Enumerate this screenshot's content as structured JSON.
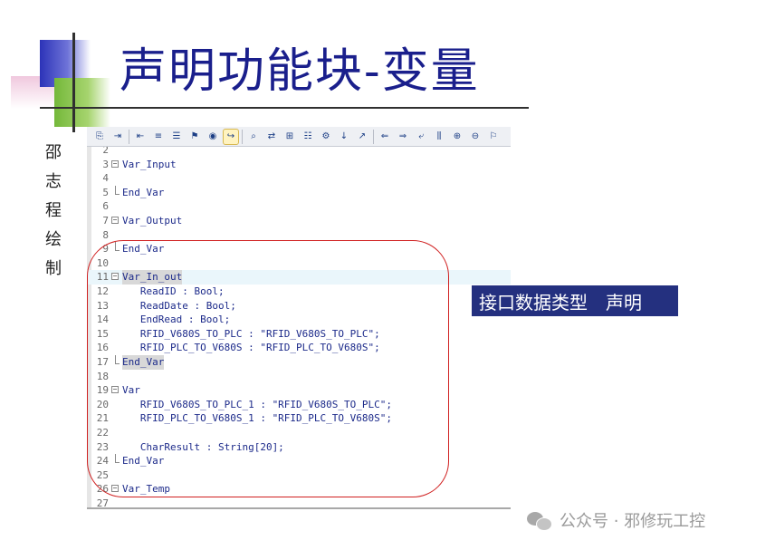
{
  "slide": {
    "title": "声明功能块-变量",
    "side_caption": "邵志程绘制",
    "callout": "接口数据类型　声明",
    "watermark": "公众号 · 邪修玩工控"
  },
  "toolbar": {
    "buttons": [
      "copy-icon",
      "indent-icon",
      "outdent-icon",
      "comment-icon",
      "uncomment-icon",
      "bookmark-icon",
      "breakpoint-icon",
      "goto-icon",
      "find-icon",
      "replace-icon",
      "toggle-icon",
      "list-icon",
      "settings-icon",
      "step-icon",
      "jump-icon",
      "align-left-icon",
      "align-right-icon",
      "wrap-icon",
      "split-icon",
      "insert-icon",
      "delete-icon",
      "flag-icon"
    ]
  },
  "editor": {
    "lines": [
      {
        "n": "2",
        "text": ""
      },
      {
        "n": "3",
        "text": "Var_Input"
      },
      {
        "n": "4",
        "text": ""
      },
      {
        "n": "5",
        "text": "End_Var"
      },
      {
        "n": "6",
        "text": ""
      },
      {
        "n": "7",
        "text": "Var_Output"
      },
      {
        "n": "8",
        "text": ""
      },
      {
        "n": "9",
        "text": "End_Var"
      },
      {
        "n": "10",
        "text": ""
      },
      {
        "n": "11",
        "text": "Var_In_out"
      },
      {
        "n": "12",
        "text": "   ReadID : Bool;"
      },
      {
        "n": "13",
        "text": "   ReadDate : Bool;"
      },
      {
        "n": "14",
        "text": "   EndRead : Bool;"
      },
      {
        "n": "15",
        "text": "   RFID_V680S_TO_PLC : \"RFID_V680S_TO_PLC\";"
      },
      {
        "n": "16",
        "text": "   RFID_PLC_TO_V680S : \"RFID_PLC_TO_V680S\";"
      },
      {
        "n": "17",
        "text": "End_Var"
      },
      {
        "n": "18",
        "text": ""
      },
      {
        "n": "19",
        "text": "Var"
      },
      {
        "n": "20",
        "text": "   RFID_V680S_TO_PLC_1 : \"RFID_V680S_TO_PLC\";"
      },
      {
        "n": "21",
        "text": "   RFID_PLC_TO_V680S_1 : \"RFID_PLC_TO_V680S\";"
      },
      {
        "n": "22",
        "text": ""
      },
      {
        "n": "23",
        "text": "   CharResult : String[20];"
      },
      {
        "n": "24",
        "text": "End_Var"
      },
      {
        "n": "25",
        "text": ""
      },
      {
        "n": "26",
        "text": "Var_Temp"
      },
      {
        "n": "27",
        "text": ""
      }
    ],
    "fold_open_lines": [
      "3",
      "7",
      "11",
      "19",
      "26"
    ],
    "fold_end_lines": [
      "5",
      "9",
      "17",
      "24"
    ],
    "highlighted_line": "11",
    "selected_lines": [
      "11",
      "17"
    ]
  },
  "colors": {
    "title": "#1a1f8c",
    "code": "#1c2a8a",
    "callout_bg": "#24307f",
    "annotation": "#d02020"
  }
}
